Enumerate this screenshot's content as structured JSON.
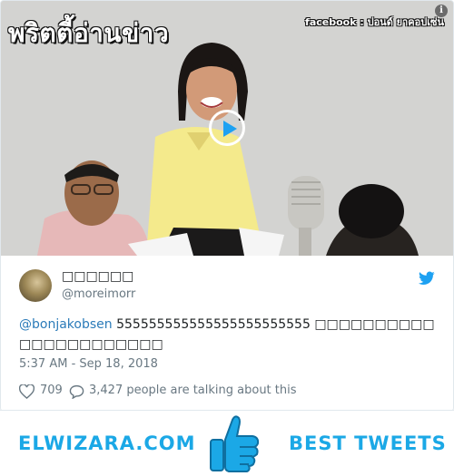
{
  "media": {
    "overlay_title": "พริตตี้อ่านข่าว",
    "facebook_tag": "facebook : ปอนด์ ยาคอปเซ่น",
    "info_glyph": "i"
  },
  "tweet": {
    "display_name": "□□□□□□",
    "handle": "@moreimorr",
    "mention": "@bonjakobsen",
    "body": " 555555555555555555555555 □□□□□□□□□□□□□□□□□□□□□□",
    "timestamp": "5:37 AM - Sep 18, 2018",
    "likes": "709",
    "talking": "3,427 people are talking about this"
  },
  "footer": {
    "left_text": "ELWIZARA.COM",
    "right_text": "BEST TWEETS"
  },
  "colors": {
    "accent": "#1da1f2",
    "footer_text": "#1ba8e6",
    "mention": "#2b7bb9",
    "muted": "#697882"
  }
}
